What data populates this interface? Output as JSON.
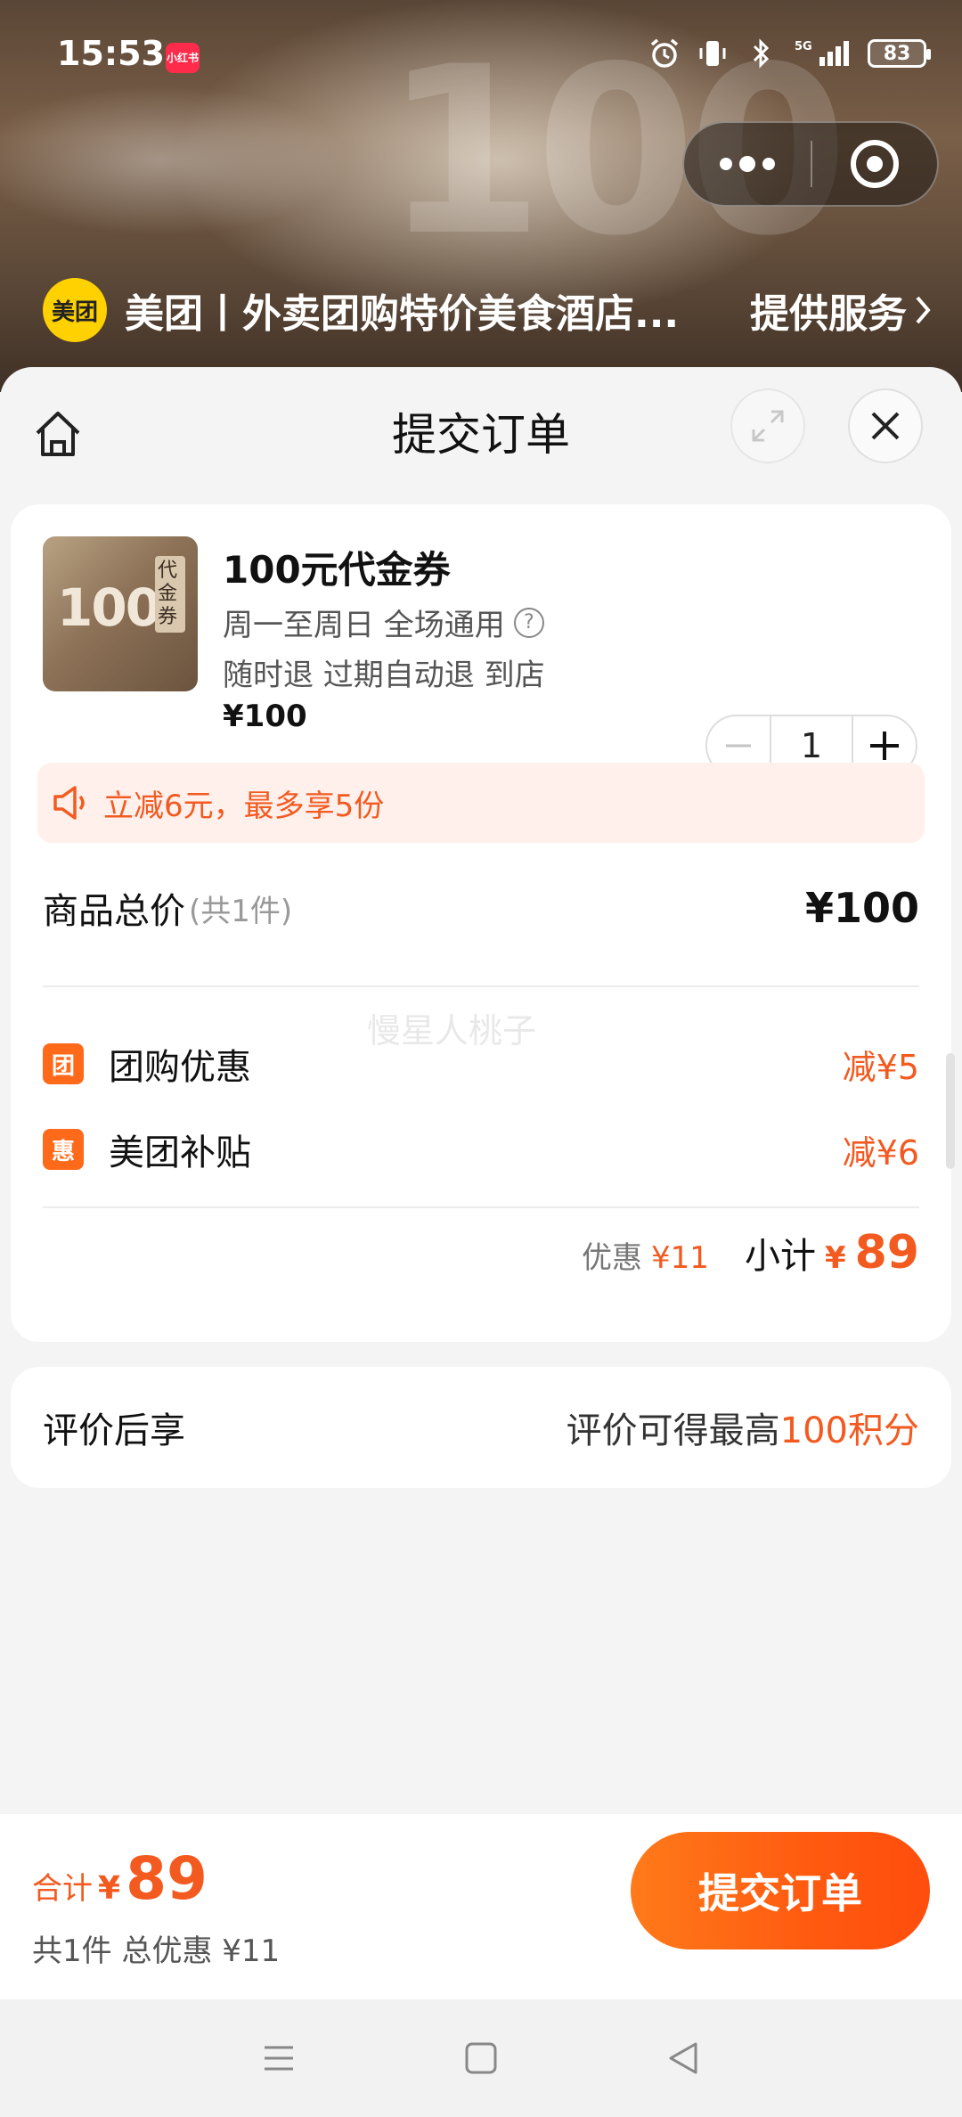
{
  "status_bar": {
    "time": "15:53",
    "app_badge": "小红书",
    "battery": "83",
    "network": "5G"
  },
  "mini_app": {
    "logo_text": "美团",
    "name": "美团丨外卖团购特价美食酒店...",
    "provide_label": "提供服务"
  },
  "sheet": {
    "title": "提交订单"
  },
  "product": {
    "image_text": "100",
    "image_side_text": "代金券",
    "name": "100元代金券",
    "usage": "周一至周日 全场通用",
    "refund": "随时退 过期自动退 到店",
    "price": "¥100",
    "quantity": "1"
  },
  "promo": {
    "text": "立减6元，最多享5份"
  },
  "totals": {
    "goods_label": "商品总价",
    "goods_count": "(共1件)",
    "goods_value": "¥100"
  },
  "discounts": [
    {
      "icon": "团",
      "label": "团购优惠",
      "value": "减¥5"
    },
    {
      "icon": "惠",
      "label": "美团补贴",
      "value": "减¥6"
    }
  ],
  "subtotal": {
    "discount_label": "优惠",
    "discount_value": "¥11",
    "label": "小计",
    "currency": "¥",
    "amount": "89"
  },
  "watermark": "慢星人桃子",
  "review": {
    "label": "评价后享",
    "text_prefix": "评价可得最高",
    "text_highlight": "100积分"
  },
  "bottom_bar": {
    "total_label": "合计",
    "currency": "¥",
    "amount": "89",
    "sub_text": "共1件 总优惠 ¥11",
    "submit_label": "提交订单"
  },
  "colors": {
    "accent": "#f35a20",
    "button": "#ff5a10",
    "promo_bg": "#fff0ec",
    "meituan_yellow": "#ffd100"
  }
}
